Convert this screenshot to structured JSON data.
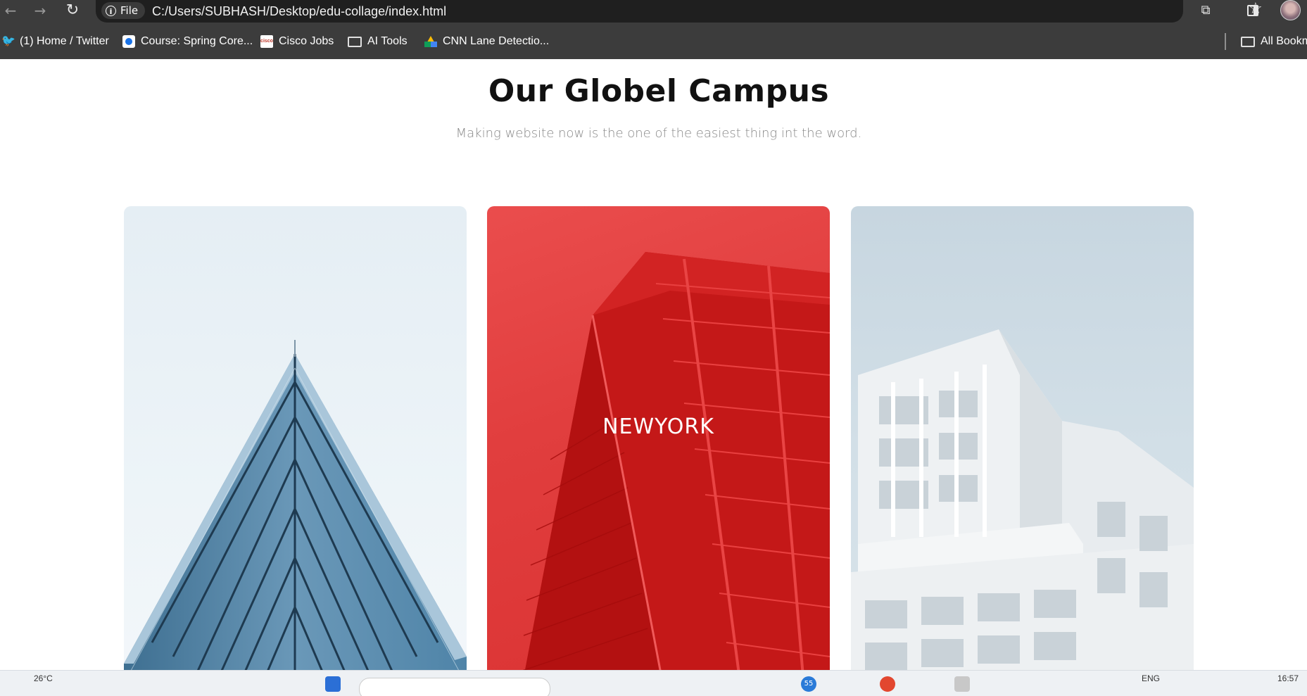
{
  "browser": {
    "site_chip": "File",
    "url": "C:/Users/SUBHASH/Desktop/edu-collage/index.html"
  },
  "bookmarks": [
    {
      "label": "(1) Home / Twitter",
      "icon": "twitter-icon"
    },
    {
      "label": "Course: Spring Core...",
      "icon": "course-icon"
    },
    {
      "label": "Cisco Jobs",
      "icon": "cisco-icon"
    },
    {
      "label": "AI Tools",
      "icon": "folder-icon"
    },
    {
      "label": "CNN Lane Detectio...",
      "icon": "google-drive-icon"
    }
  ],
  "all_bookmarks": "All Bookm",
  "page": {
    "title": "Our Globel Campus",
    "subtitle": "Making website now is the one of the easiest thing int the word."
  },
  "cards": [
    {
      "label": ""
    },
    {
      "label": "NEWYORK"
    },
    {
      "label": ""
    }
  ],
  "taskbar": {
    "temperature": "26°C",
    "lang": "ENG",
    "time": "16:57",
    "badge": "55"
  },
  "colors": {
    "accent_red": "#e13e3e",
    "chrome_dark": "#3c3c3c",
    "omnibox": "#1f1f1f"
  }
}
